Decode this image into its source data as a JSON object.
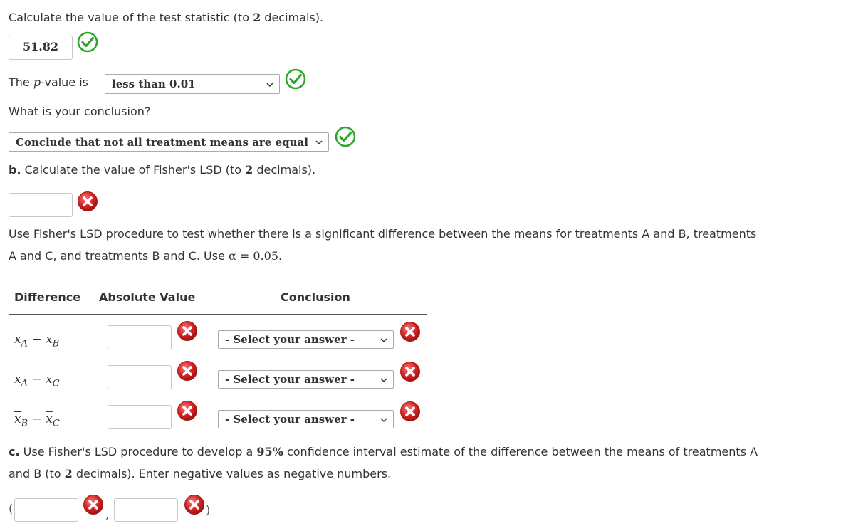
{
  "q_test_stat": {
    "prompt_pre": "Calculate the value of the test statistic (to ",
    "num": "2",
    "prompt_post": " decimals).",
    "value": "51.82"
  },
  "q_pvalue": {
    "label_pre": "The ",
    "p": "p",
    "label_post": "-value is",
    "selected": "less than 0.01"
  },
  "q_conclusion": {
    "prompt": "What is your conclusion?",
    "selected": "Conclude that not all treatment means are equal"
  },
  "part_b": {
    "letter": "b.",
    "prompt_pre": " Calculate the value of Fisher's LSD (to ",
    "num": "2",
    "prompt_post": " decimals).",
    "value": ""
  },
  "lsd_intro": {
    "line1": "Use Fisher's LSD procedure to test whether there is a significant difference between the means for treatments A and B, treatments",
    "line2_pre": "A and C, and treatments B and C. Use ",
    "alpha": "α = 0.05",
    "line2_post": "."
  },
  "table": {
    "headers": {
      "difference": "Difference",
      "absolute_value": "Absolute Value",
      "conclusion": "Conclusion"
    },
    "rows": [
      {
        "x1": "x",
        "s1": "A",
        "x2": "x",
        "s2": "B",
        "value": "",
        "select": "- Select your answer -"
      },
      {
        "x1": "x",
        "s1": "A",
        "x2": "x",
        "s2": "C",
        "value": "",
        "select": "- Select your answer -"
      },
      {
        "x1": "x",
        "s1": "B",
        "x2": "x",
        "s2": "C",
        "value": "",
        "select": "- Select your answer -"
      }
    ],
    "minus": "−"
  },
  "part_c": {
    "letter": "c.",
    "line1_pre": " Use Fisher's LSD procedure to develop a ",
    "pct": "95%",
    "line1_post": " confidence interval estimate of the difference between the means of treatments A",
    "line2_pre": "and B (to ",
    "num": "2",
    "line2_post": " decimals). Enter negative values as negative numbers.",
    "open_paren": "(",
    "comma": ",",
    "close_paren": ")",
    "lower": "",
    "upper": ""
  },
  "colors": {
    "correct": "#2fa52f",
    "incorrect": "#cc1f1f"
  },
  "icons": {
    "correct": "check-circle-icon",
    "incorrect": "x-circle-icon",
    "dropdown": "chevron-down-icon"
  }
}
